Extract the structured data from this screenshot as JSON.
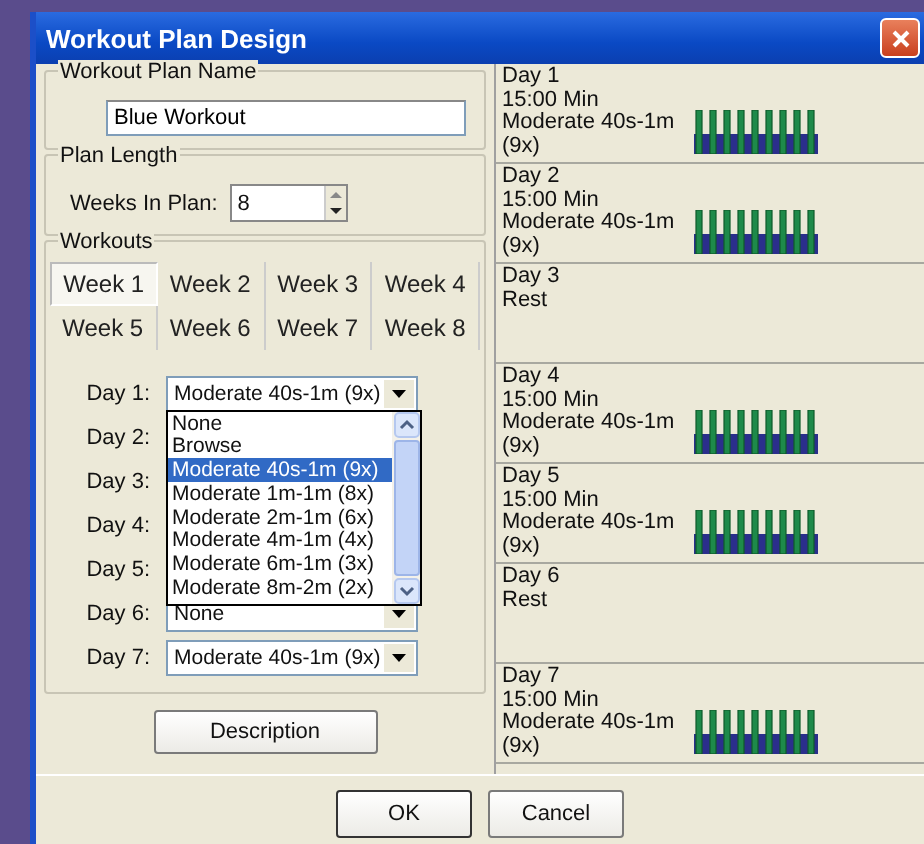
{
  "window": {
    "title": "Workout Plan Design"
  },
  "plan_name": {
    "label": "Workout Plan Name",
    "value": "Blue Workout"
  },
  "plan_length": {
    "label": "Plan Length",
    "weeks_label": "Weeks In Plan:",
    "weeks_value": "8"
  },
  "workouts": {
    "label": "Workouts",
    "weeks": [
      {
        "label": "Week 1",
        "selected": true
      },
      {
        "label": "Week 2",
        "selected": false
      },
      {
        "label": "Week 3",
        "selected": false
      },
      {
        "label": "Week 4",
        "selected": false
      },
      {
        "label": "Week 5",
        "selected": false
      },
      {
        "label": "Week 6",
        "selected": false
      },
      {
        "label": "Week 7",
        "selected": false
      },
      {
        "label": "Week 8",
        "selected": false
      }
    ],
    "days": [
      {
        "label": "Day 1:",
        "value": "Moderate 40s-1m (9x)",
        "open": true
      },
      {
        "label": "Day 2:"
      },
      {
        "label": "Day 3:"
      },
      {
        "label": "Day 4:"
      },
      {
        "label": "Day 5:"
      },
      {
        "label": "Day 6:",
        "value": "None",
        "open": false
      },
      {
        "label": "Day 7:",
        "value": "Moderate 40s-1m (9x)",
        "open": false
      }
    ],
    "dropdown": [
      {
        "label": "None",
        "selected": false
      },
      {
        "label": "Browse",
        "selected": false
      },
      {
        "label": "Moderate 40s-1m (9x)",
        "selected": true
      },
      {
        "label": "Moderate 1m-1m (8x)",
        "selected": false
      },
      {
        "label": "Moderate 2m-1m (6x)",
        "selected": false
      },
      {
        "label": "Moderate 4m-1m (4x)",
        "selected": false
      },
      {
        "label": "Moderate 6m-1m (3x)",
        "selected": false
      },
      {
        "label": "Moderate 8m-2m (2x)",
        "selected": false
      }
    ]
  },
  "description_button": "Description",
  "schedule": [
    {
      "day": "Day 1",
      "kind": "workout",
      "duration": "15:00 Min",
      "workout": "Moderate 40s-1m (9x)"
    },
    {
      "day": "Day 2",
      "kind": "workout",
      "duration": "15:00 Min",
      "workout": "Moderate 40s-1m (9x)"
    },
    {
      "day": "Day 3",
      "kind": "rest",
      "note": "Rest"
    },
    {
      "day": "Day 4",
      "kind": "workout",
      "duration": "15:00 Min",
      "workout": "Moderate 40s-1m (9x)"
    },
    {
      "day": "Day 5",
      "kind": "workout",
      "duration": "15:00 Min",
      "workout": "Moderate 40s-1m (9x)"
    },
    {
      "day": "Day 6",
      "kind": "rest",
      "note": "Rest"
    },
    {
      "day": "Day 7",
      "kind": "workout",
      "duration": "15:00 Min",
      "workout": "Moderate 40s-1m (9x)"
    }
  ],
  "buttons": [
    {
      "label": "OK"
    },
    {
      "label": "Cancel"
    }
  ]
}
